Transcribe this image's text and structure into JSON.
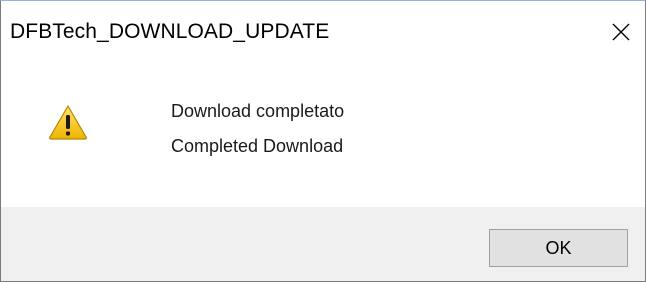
{
  "window": {
    "title": "DFBTech_DOWNLOAD_UPDATE",
    "close_icon": "close-icon"
  },
  "message": {
    "icon": "warning-icon",
    "line1": "Download completato",
    "line2": "Completed Download"
  },
  "buttons": {
    "ok_label": "OK"
  },
  "colors": {
    "warning_yellow": "#f5c518",
    "footer_bg": "#f0f0f0",
    "button_bg": "#e1e1e1"
  }
}
